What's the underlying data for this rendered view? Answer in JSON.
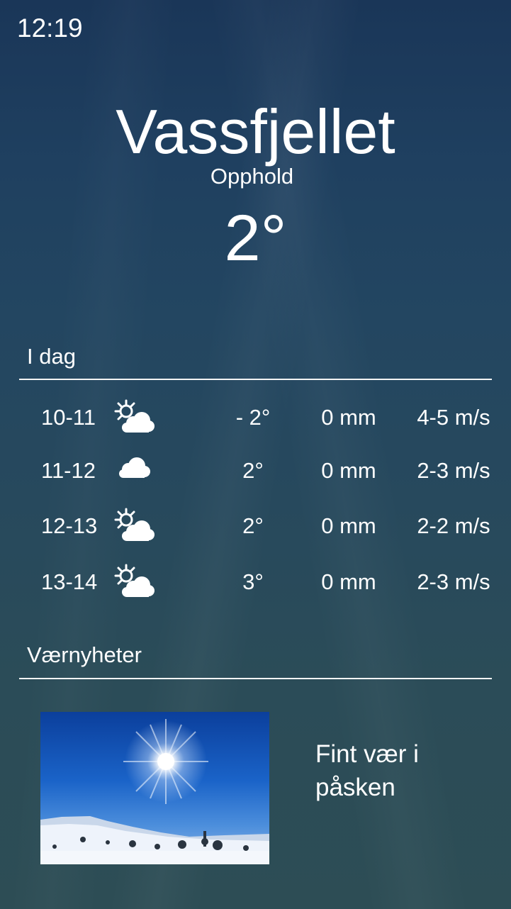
{
  "status_bar": {
    "time": "12:19"
  },
  "location": {
    "name": "Vassfjellet",
    "condition": "Opphold",
    "temperature": "2°"
  },
  "today": {
    "title": "I dag",
    "rows": [
      {
        "time": "10-11",
        "icon": "partly-cloudy-icon",
        "temp": "- 2°",
        "precip": "0 mm",
        "wind": "4-5 m/s"
      },
      {
        "time": "11-12",
        "icon": "cloudy-icon",
        "temp": "2°",
        "precip": "0 mm",
        "wind": "2-3 m/s"
      },
      {
        "time": "12-13",
        "icon": "partly-cloudy-icon",
        "temp": "2°",
        "precip": "0 mm",
        "wind": "2-2 m/s"
      },
      {
        "time": "13-14",
        "icon": "partly-cloudy-icon",
        "temp": "3°",
        "precip": "0 mm",
        "wind": "2-3 m/s"
      }
    ]
  },
  "news": {
    "title": "Værnyheter",
    "items": [
      {
        "headline": "Fint vær i påsken",
        "image": "sunny-snow-landscape"
      }
    ]
  }
}
